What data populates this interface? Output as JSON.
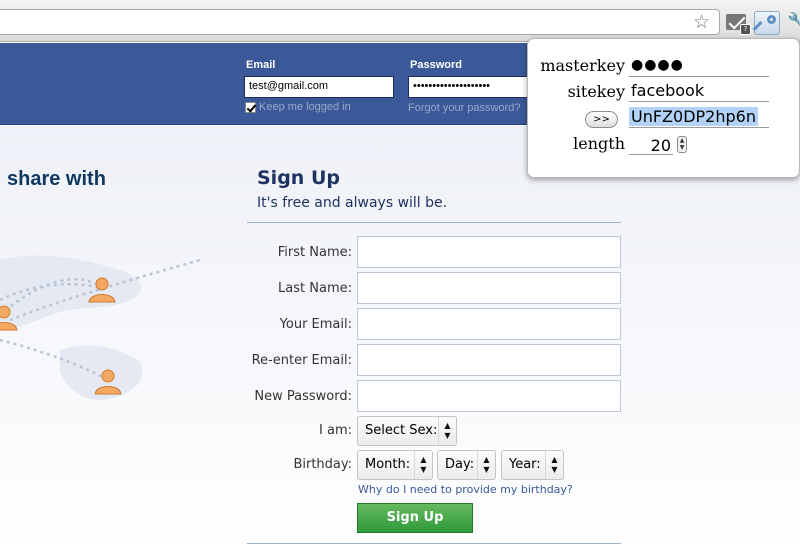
{
  "browser": {
    "star_icon": "star-icon",
    "mail_extension_icon": "mail-extension-icon",
    "mail_badge": "?",
    "key_extension_icon": "key-extension-icon",
    "wrench_icon": "wrench-icon"
  },
  "header": {
    "email_label": "Email",
    "email_value": "test@gmail.com",
    "password_label": "Password",
    "password_value": "••••••••••••••••••••",
    "keep_logged_in": "Keep me logged in",
    "keep_logged_in_checked": true,
    "forgot_password": "Forgot your password?",
    "background_color": "#3b5998"
  },
  "left": {
    "tagline": "share with"
  },
  "signup": {
    "title": "Sign Up",
    "subtitle": "It's free and always will be.",
    "fields": {
      "first_name": "First Name:",
      "last_name": "Last Name:",
      "your_email": "Your Email:",
      "reenter_email": "Re-enter Email:",
      "new_password": "New Password:"
    },
    "i_am_label": "I am:",
    "sex_select": "Select Sex:",
    "birthday_label": "Birthday:",
    "month_select": "Month:",
    "day_select": "Day:",
    "year_select": "Year:",
    "why_link": "Why do I need to provide my birthday?",
    "button": "Sign Up",
    "button_color": "#2e9a3b"
  },
  "popup": {
    "masterkey_label": "masterkey",
    "masterkey_value": "●●●●",
    "sitekey_label": "sitekey",
    "sitekey_value": "facebook",
    "go_button": ">>",
    "generated_password": "UnFZ0DP2hp6n",
    "length_label": "length",
    "length_value": "20"
  }
}
